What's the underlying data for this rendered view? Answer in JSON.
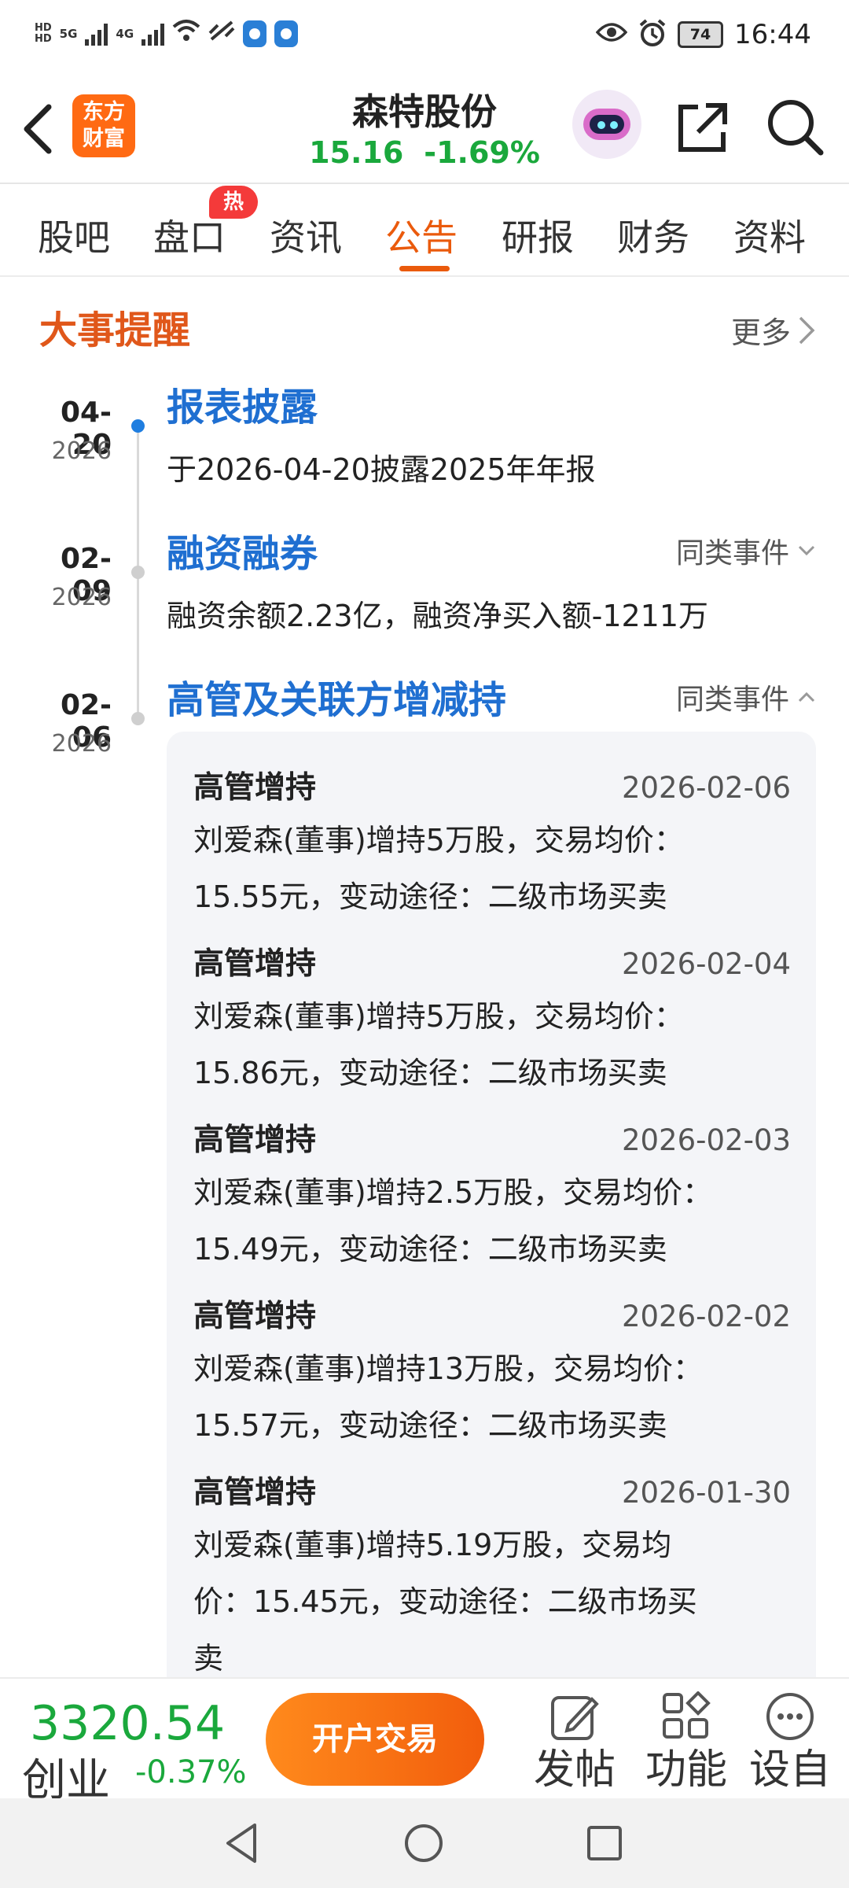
{
  "status_bar": {
    "hd1": "HD",
    "hd2": "HD",
    "net1": "5G",
    "net2": "4G",
    "battery": "74",
    "time": "16:44"
  },
  "header": {
    "logo_line1": "东方",
    "logo_line2": "财富",
    "stock_name": "森特股份",
    "price": "15.16",
    "change_pct": "-1.69%"
  },
  "tabs": [
    {
      "label": "股吧"
    },
    {
      "label": "盘口"
    },
    {
      "label": "资讯"
    },
    {
      "label": "公告"
    },
    {
      "label": "研报"
    },
    {
      "label": "财务"
    },
    {
      "label": "资料"
    }
  ],
  "hot_badge": "热",
  "events_section": {
    "title": "大事提醒",
    "more": "更多",
    "similar_label": "同类事件"
  },
  "events": [
    {
      "date_md": "04-20",
      "year": "2026",
      "title": "报表披露",
      "desc": "于2026-04-20披露2025年年报"
    },
    {
      "date_md": "02-09",
      "year": "2026",
      "title": "融资融券",
      "desc": "融资余额2.23亿，融资净买入额-1211万"
    },
    {
      "date_md": "02-06",
      "year": "2026",
      "title": "高管及关联方增减持"
    }
  ],
  "holding_changes": [
    {
      "type": "高管增持",
      "date": "2026-02-06",
      "line1": "刘爱森(董事)增持5万股，交易均价：",
      "line2": "15.55元，变动途径：二级市场买卖"
    },
    {
      "type": "高管增持",
      "date": "2026-02-04",
      "line1": "刘爱森(董事)增持5万股，交易均价：",
      "line2": "15.86元，变动途径：二级市场买卖"
    },
    {
      "type": "高管增持",
      "date": "2026-02-03",
      "line1": "刘爱森(董事)增持2.5万股，交易均价：",
      "line2": "15.49元，变动途径：二级市场买卖"
    },
    {
      "type": "高管增持",
      "date": "2026-02-02",
      "line1": "刘爱森(董事)增持13万股，交易均价：",
      "line2": "15.57元，变动途径：二级市场买卖"
    },
    {
      "type": "高管增持",
      "date": "2026-01-30",
      "line1": "刘爱森(董事)增持5.19万股，交易均",
      "line2": "价：15.45元，变动途径：二级市场买",
      "line3": "卖"
    }
  ],
  "bottom_bar": {
    "index_value": "3320.54",
    "index_name": "创业",
    "index_change": "-0.37%",
    "open_account": "开户交易",
    "post": "发帖",
    "functions": "功能",
    "settings": "设自"
  },
  "colors": {
    "accent": "#ea5a0c",
    "down_green": "#1aa83c",
    "event_blue": "#1f6fd1"
  }
}
